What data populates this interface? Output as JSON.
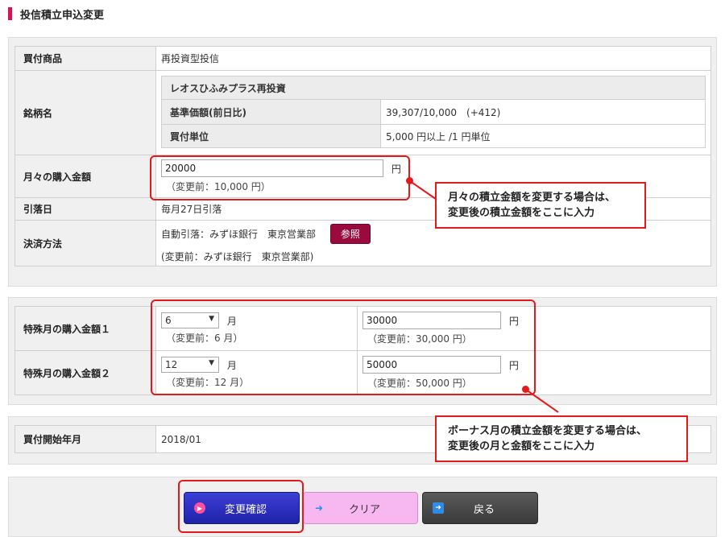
{
  "page": {
    "title": "投信積立申込変更"
  },
  "section1": {
    "product": {
      "label": "買付商品",
      "value": "再投資型投信"
    },
    "fund": {
      "label": "銘柄名",
      "name": "レオスひふみプラス再投資",
      "base_price_label": "基準価額(前日比)",
      "base_price_value": "39,307/10,000　(+412)",
      "unit_label": "買付単位",
      "unit_value": "5,000 円以上 /1 円単位"
    },
    "monthly": {
      "label": "月々の購入金額",
      "value": "20000",
      "unit": "円",
      "note": "（変更前：10,000 円）"
    },
    "debit_day": {
      "label": "引落日",
      "value": "毎月27日引落"
    },
    "payment": {
      "label": "決済方法",
      "value": "自動引落：みずほ銀行　東京営業部",
      "ref_button": "参照",
      "note": "(変更前：みずほ銀行　東京営業部)"
    }
  },
  "section2": {
    "special1": {
      "label": "特殊月の購入金額１",
      "month": "6",
      "month_unit": "月",
      "month_note": "（変更前：6 月）",
      "amount": "30000",
      "amount_unit": "円",
      "amount_note": "（変更前：30,000 円）"
    },
    "special2": {
      "label": "特殊月の購入金額２",
      "month": "12",
      "month_unit": "月",
      "month_note": "（変更前：12 月）",
      "amount": "50000",
      "amount_unit": "円",
      "amount_note": "（変更前：50,000 円）"
    }
  },
  "section3": {
    "start": {
      "label": "買付開始年月",
      "value": "2018/01"
    }
  },
  "callouts": {
    "monthly": [
      "月々の積立金額を変更する場合は、",
      "変更後の積立金額をここに入力"
    ],
    "bonus": [
      "ボーナス月の積立金額を変更する場合は、",
      "変更後の月と金額をここに入力"
    ]
  },
  "buttons": {
    "confirm": "変更確認",
    "clear": "クリア",
    "back": "戻る"
  },
  "colors": {
    "accent": "#d4145a",
    "highlight": "#e21a1a",
    "confirm_bg": "#2b2fc4",
    "clear_bg": "#f5b3f0",
    "back_bg": "#4a4a4a"
  }
}
